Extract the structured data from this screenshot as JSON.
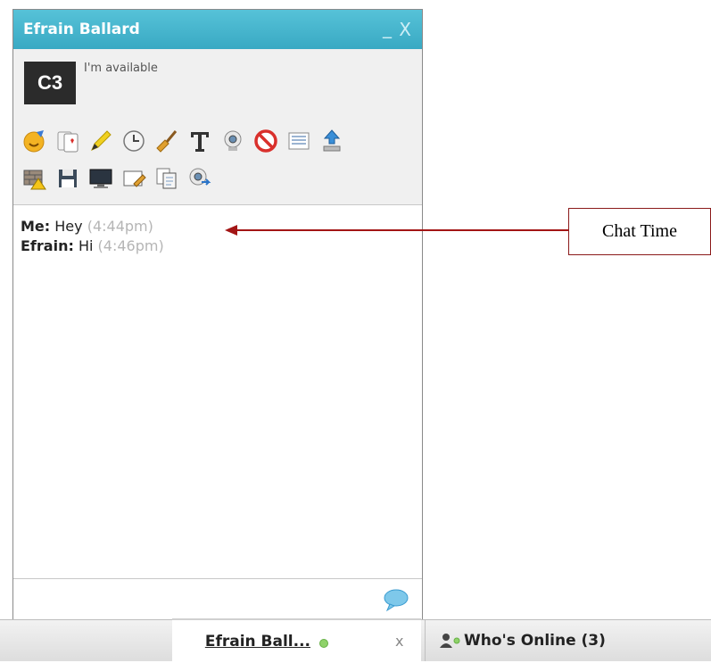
{
  "chat_window": {
    "title": "Efrain Ballard",
    "minimize_label": "_",
    "close_label": "X",
    "avatar_text": "C3",
    "status_text": "I'm available",
    "tools_row1": [
      "smiley-icon",
      "cards-icon",
      "pencil-icon",
      "clock-icon",
      "broom-icon",
      "text-format-icon",
      "webcam-icon",
      "block-icon",
      "list-icon",
      "upload-icon"
    ],
    "tools_row2": [
      "firewall-warning-icon",
      "save-icon",
      "monitor-icon",
      "edit-note-icon",
      "copy-document-icon",
      "webcam-share-icon"
    ],
    "messages": [
      {
        "sender": "Me:",
        "text": "Hey",
        "time": "(4:44pm)"
      },
      {
        "sender": "Efrain:",
        "text": "Hi",
        "time": "(4:46pm)"
      }
    ],
    "input_placeholder": ""
  },
  "bottom_bar": {
    "active_tab_label": "Efrain Ball...",
    "tab_close_label": "x",
    "whos_online_label": "Who's Online (3)"
  },
  "callout": {
    "label": "Chat Time"
  },
  "colors": {
    "title_bar": "#3fb1ca",
    "arrow": "#a31515",
    "timestamp": "#b5b5b5",
    "online_dot": "#8fd26a"
  }
}
